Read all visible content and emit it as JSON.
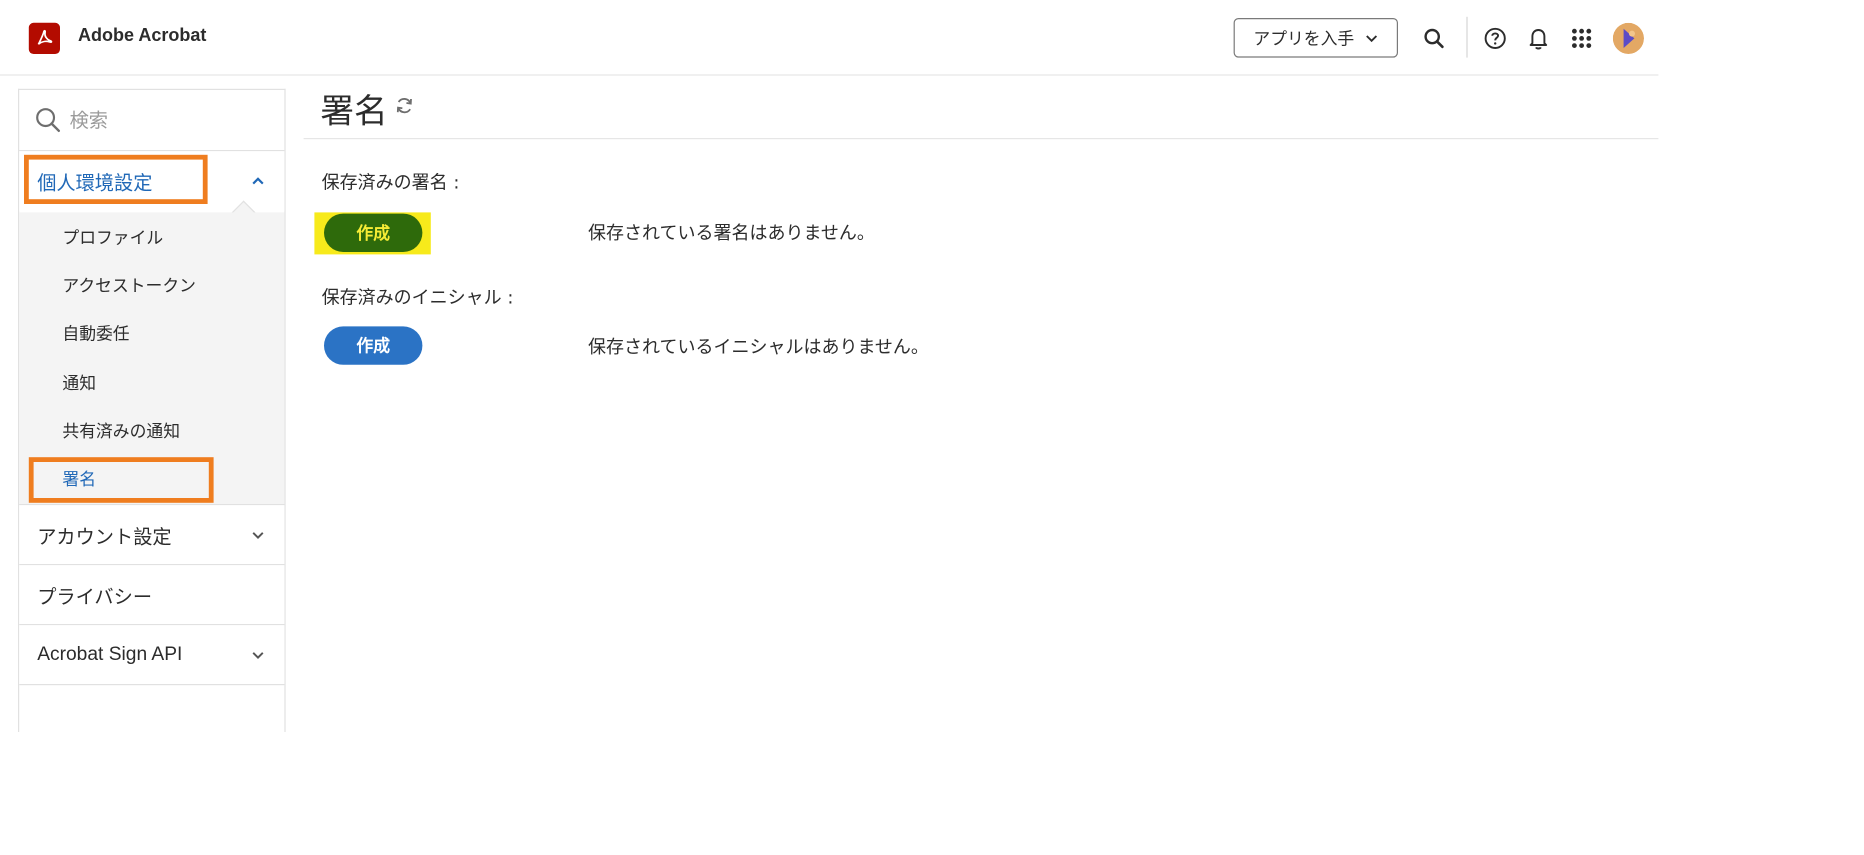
{
  "header": {
    "brand": "Adobe Acrobat",
    "get_apps_label": "アプリを入手",
    "icons": [
      "search-icon",
      "help-icon",
      "bell-icon",
      "app-grid-icon",
      "avatar"
    ]
  },
  "sidebar": {
    "search_placeholder": "検索",
    "sections": {
      "personal": {
        "label": "個人環境設定",
        "items": [
          "プロファイル",
          "アクセストークン",
          "自動委任",
          "通知",
          "共有済みの通知",
          "署名"
        ],
        "selected": "署名"
      },
      "account": {
        "label": "アカウント設定"
      },
      "privacy": {
        "label": "プライバシー"
      },
      "sign_api": {
        "label": "Acrobat Sign API"
      }
    }
  },
  "main": {
    "title": "署名",
    "signatures": {
      "label": "保存済みの署名 :",
      "button": "作成",
      "empty": "保存されている署名はありません。"
    },
    "initials": {
      "label": "保存済みのイニシャル :",
      "button": "作成",
      "empty": "保存されているイニシャルはありません。"
    }
  },
  "colors": {
    "acrobat_red": "#b30b00",
    "link_blue": "#2068b7",
    "highlight_orange": "#ef7d1f",
    "highlight_yellow": "#f7ea1b",
    "button_blue": "#2b73c5",
    "button_green": "#2e6a0b"
  }
}
